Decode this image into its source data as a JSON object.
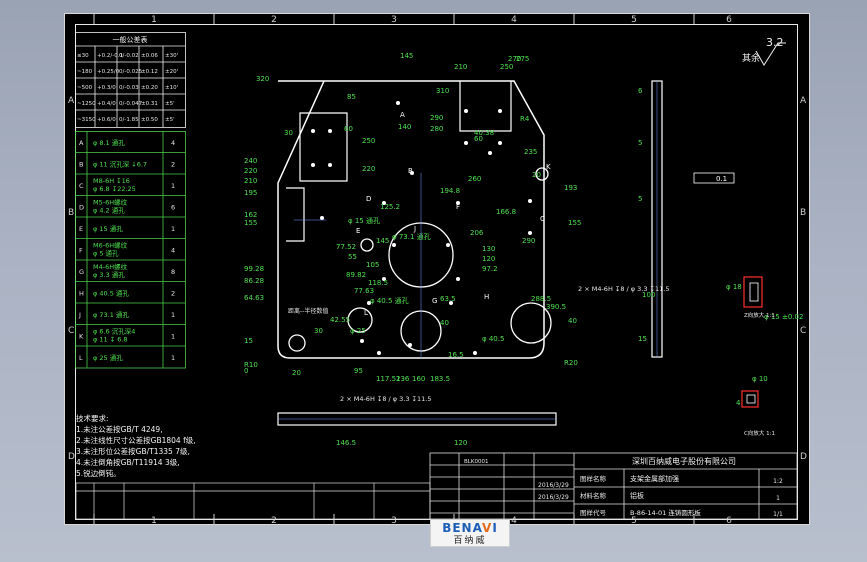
{
  "title_block": {
    "company": "深圳百纳威电子股份有限公司",
    "drawing_name": "支架金属部加强",
    "material": "铝板",
    "part_number": "B-86-14-01 连铸圆形板",
    "label_name": "图样名称",
    "label_material": "材料名称",
    "label_number": "图样代号",
    "date1": "2016/3/29",
    "date2": "2016/3/29",
    "scale": "1:2",
    "sheet": "1",
    "sheets": "1/1",
    "designer": "BLK0001"
  },
  "surface_finish": {
    "label": "其余",
    "value": "3.2"
  },
  "tolerance_table": {
    "title": "一般公差表",
    "rows": [
      [
        "≤30",
        "+0.2/-0.1",
        "0/-0.02",
        "±0.06",
        "±30'"
      ],
      [
        "~180",
        "+0.25/0",
        "0/-0.025",
        "±0.12",
        "±20'"
      ],
      [
        "~500",
        "+0.3/0",
        "0/-0.03",
        "±0.20",
        "±10'"
      ],
      [
        "~1250",
        "+0.4/0",
        "0/-0.047",
        "±0.31",
        "±5'"
      ],
      [
        "~3150",
        "+0.6/0",
        "0/-1.85",
        "±0.50",
        "±5'"
      ]
    ]
  },
  "hole_table": {
    "rows": [
      [
        "A",
        "φ 8.1  通孔",
        "4"
      ],
      [
        "B",
        "φ 11  沉孔深 ↓6.7",
        "2"
      ],
      [
        "C",
        "M8-6H ↧16 / φ 6.8 ↧22.25",
        "1"
      ],
      [
        "D",
        "M5-6H螺纹 / φ 4.2 通孔",
        "6"
      ],
      [
        "E",
        "φ 15  通孔",
        "1"
      ],
      [
        "F",
        "M6-6H螺纹 / φ 5 通孔",
        "4"
      ],
      [
        "G",
        "M4-6H螺纹 / φ 3.3 通孔",
        "8"
      ],
      [
        "H",
        "φ 40.5  通孔",
        "2"
      ],
      [
        "J",
        "φ 73.1  通孔",
        "1"
      ],
      [
        "K",
        "φ 6.6 沉孔深4 / φ 11 ↧ 6.8",
        "1"
      ],
      [
        "L",
        "φ 25  通孔",
        "1"
      ]
    ]
  },
  "tech_notes": {
    "title": "技术要求:",
    "lines": [
      "1.未注公差按GB/T 4249,",
      "2.未注线性尺寸公差按GB1804  f级,",
      "3.未注形位公差按GB/T1335  7级,",
      "4.未注倒角按GB/T11914 3级,",
      "5.锐边倒钝。"
    ]
  },
  "grid": {
    "cols": [
      "1",
      "2",
      "3",
      "4",
      "5",
      "6"
    ],
    "rows": [
      "A",
      "B",
      "C",
      "D"
    ]
  },
  "front_view": {
    "dims_left": [
      "240",
      "220",
      "210",
      "195",
      "162",
      "155",
      "99.28",
      "86.28",
      "64.63",
      "15",
      "R10",
      "0"
    ],
    "dims_top": [
      "320",
      "145",
      "85",
      "60",
      "30",
      "210",
      "250",
      "270",
      "275",
      "310",
      "290",
      "280",
      "40.38",
      "60"
    ],
    "dims_right": [
      "R4",
      "235",
      "193",
      "155",
      "290",
      "130",
      "120",
      "97.2",
      "166.8",
      "194.8",
      "20",
      "40",
      "R20"
    ],
    "dims_bottom": [
      "20",
      "30",
      "95",
      "117.52",
      "136",
      "160",
      "183.5",
      "16.5",
      "42.55",
      "288.5",
      "390.5"
    ],
    "dims_inner": [
      "250",
      "220",
      "145",
      "140",
      "260",
      "125.2",
      "105",
      "118.5",
      "77.52",
      "55",
      "89.82",
      "77.63",
      "63.5",
      "40",
      "206",
      "φ 15 通孔",
      "φ 73.1 通孔",
      "φ 40.5 通孔",
      "φ 40.5",
      "φ 25"
    ],
    "labels": [
      "A",
      "B",
      "C",
      "D",
      "E",
      "F",
      "G",
      "H",
      "J",
      "K",
      "L"
    ],
    "note": "距离--半径数值"
  },
  "side_view": {
    "dims": [
      "6",
      "5",
      "5",
      "100",
      "15"
    ],
    "callout": "2 × M4-6H ↧8 / φ 3.3 ↧11.5",
    "flatness": "0.1"
  },
  "bottom_view": {
    "callout": "2 × M4-6H ↧8 / φ 3.3 ↧11.5",
    "dims": [
      "146.5",
      "120"
    ]
  },
  "detail_views": {
    "dims": [
      "φ 18",
      "φ 15 ±0.02",
      "φ 10",
      "4"
    ],
    "labels": [
      "Z向放大 1:1",
      "C向放大 1:1"
    ]
  }
}
